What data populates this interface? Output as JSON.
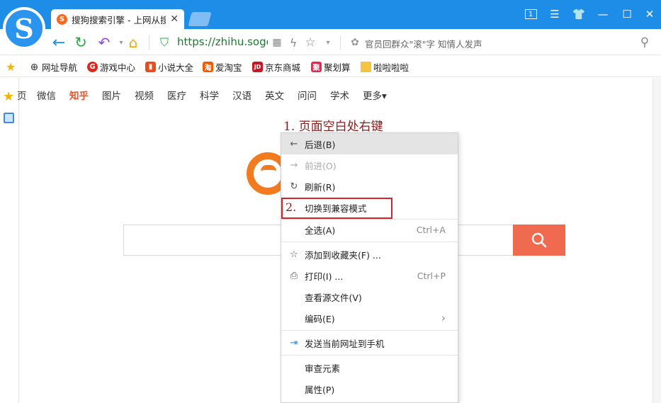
{
  "tab": {
    "title": "搜狗搜索引擎 - 上网从搜狗开始",
    "favicon": "S"
  },
  "address": {
    "url": "https://zhihu.sogou",
    "hint": "官员回群众\"滚\"字 知情人发声"
  },
  "bookmarks": [
    {
      "label": "网址导航",
      "icon": "globe-icon",
      "color": "#555555"
    },
    {
      "label": "游戏中心",
      "icon": "game-icon",
      "color": "#e0261b"
    },
    {
      "label": "小说大全",
      "icon": "novel-icon",
      "color": "#e84e1b"
    },
    {
      "label": "爱淘宝",
      "icon": "taobao-icon",
      "color": "#f25a00",
      "glyph": "淘"
    },
    {
      "label": "京东商城",
      "icon": "jd-icon",
      "color": "#c91623",
      "glyph": "JD"
    },
    {
      "label": "聚划算",
      "icon": "juhuasuan-icon",
      "color": "#e8264f",
      "glyph": "聚"
    },
    {
      "label": "啦啦啦啦",
      "icon": "folder-icon",
      "color": "#f5c542"
    }
  ],
  "categories": [
    {
      "label": "页",
      "color": "#333333"
    },
    {
      "label": "微信",
      "color": "#333333"
    },
    {
      "label": "知乎",
      "color": "#e8542c"
    },
    {
      "label": "图片",
      "color": "#333333"
    },
    {
      "label": "视频",
      "color": "#333333"
    },
    {
      "label": "医疗",
      "color": "#333333"
    },
    {
      "label": "科学",
      "color": "#333333"
    },
    {
      "label": "汉语",
      "color": "#333333"
    },
    {
      "label": "英文",
      "color": "#333333"
    },
    {
      "label": "问问",
      "color": "#333333"
    },
    {
      "label": "学术",
      "color": "#333333"
    },
    {
      "label": "更多▾",
      "color": "#333333"
    }
  ],
  "annotations": {
    "step1": "1. 页面空白处右键",
    "step2": "2."
  },
  "menu": [
    {
      "label": "后退(B)",
      "icon": "arrow-left-icon",
      "glyph": "←",
      "hover": true
    },
    {
      "label": "前进(O)",
      "icon": "arrow-right-icon",
      "glyph": "→",
      "disabled": true
    },
    {
      "label": "刷新(R)",
      "icon": "refresh-icon",
      "glyph": "↻"
    },
    {
      "label": "切换到兼容模式"
    },
    {
      "label": "全选(A)",
      "shortcut": "Ctrl+A"
    },
    {
      "label": "添加到收藏夹(F) ...",
      "icon": "star-outline-icon",
      "glyph": "☆"
    },
    {
      "label": "打印(I) ...",
      "icon": "printer-icon",
      "glyph": "⎙",
      "shortcut": "Ctrl+P"
    },
    {
      "label": "查看源文件(V)"
    },
    {
      "label": "编码(E)",
      "submenu": true
    },
    {
      "label": "发送当前网址到手机",
      "icon": "send-phone-icon",
      "glyph": "⇥"
    },
    {
      "label": "审查元素"
    },
    {
      "label": "属性(P)"
    }
  ]
}
